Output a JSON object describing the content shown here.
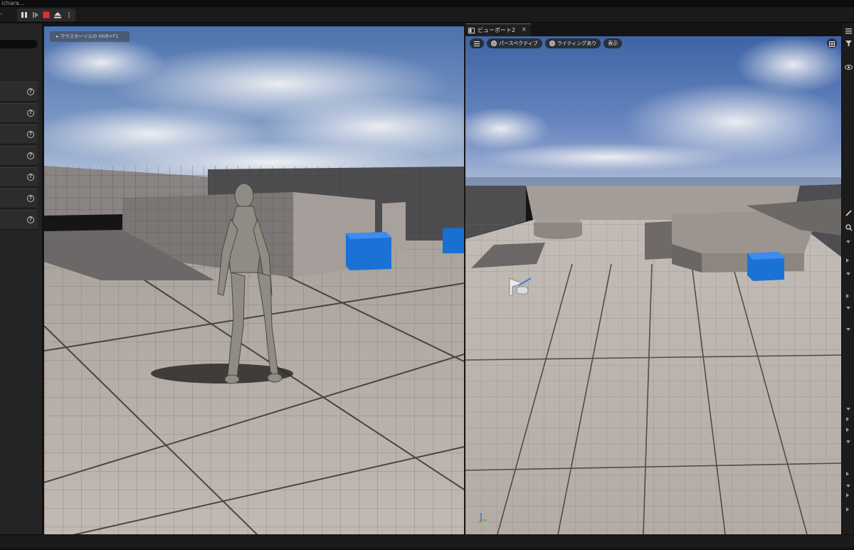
{
  "window": {
    "title_fragment": "ichara..."
  },
  "toolbar": {
    "pause_icon": "pause-icon",
    "frame_skip_icon": "frame-skip-icon",
    "stop_icon": "stop-icon",
    "eject_icon": "eject-icon",
    "more_icon": "more-vertical-icon",
    "stop_color": "#e03030"
  },
  "left_panel": {
    "rows": [
      {
        "help": "?"
      },
      {
        "help": "?"
      },
      {
        "help": "?"
      },
      {
        "help": "?"
      },
      {
        "help": "?"
      },
      {
        "help": "?"
      },
      {
        "help": "?"
      }
    ]
  },
  "viewport1": {
    "hint": "▸ マウスカーソルの Shift+F1"
  },
  "viewport2": {
    "tab_label": "ビューポート2",
    "tab_close": "×",
    "perspective_label": "パースペクティブ",
    "lighting_label": "ライティングあり",
    "show_label": "表示"
  },
  "colors": {
    "accent": "#2f6fb8",
    "cube_blue": "#1a72d6",
    "sky_top": "#4a6ea8",
    "floor": "#b6ada7"
  }
}
